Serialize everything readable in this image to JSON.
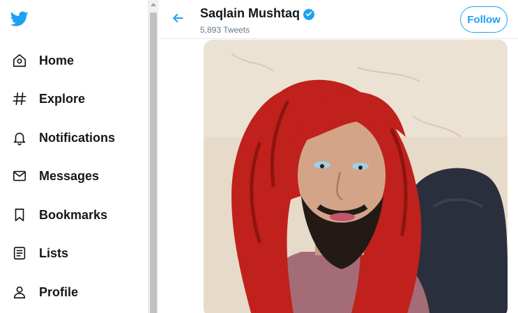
{
  "sidebar": {
    "logo_icon": "twitter-bird-icon",
    "items": [
      {
        "label": "Home",
        "icon": "home-icon"
      },
      {
        "label": "Explore",
        "icon": "hashtag-icon"
      },
      {
        "label": "Notifications",
        "icon": "bell-icon"
      },
      {
        "label": "Messages",
        "icon": "envelope-icon"
      },
      {
        "label": "Bookmarks",
        "icon": "bookmark-icon"
      },
      {
        "label": "Lists",
        "icon": "list-icon"
      },
      {
        "label": "Profile",
        "icon": "person-icon"
      }
    ]
  },
  "header": {
    "back_icon": "arrow-left-icon",
    "name": "Saqlain Mushtaq",
    "verified_icon": "verified-badge-icon",
    "tweet_count": "5,893 Tweets",
    "follow_label": "Follow"
  },
  "media": {
    "kind": "photo"
  },
  "colors": {
    "accent": "#1da1f2",
    "text": "#14171a",
    "secondary_text": "#657786",
    "border": "#e6ecf0"
  }
}
